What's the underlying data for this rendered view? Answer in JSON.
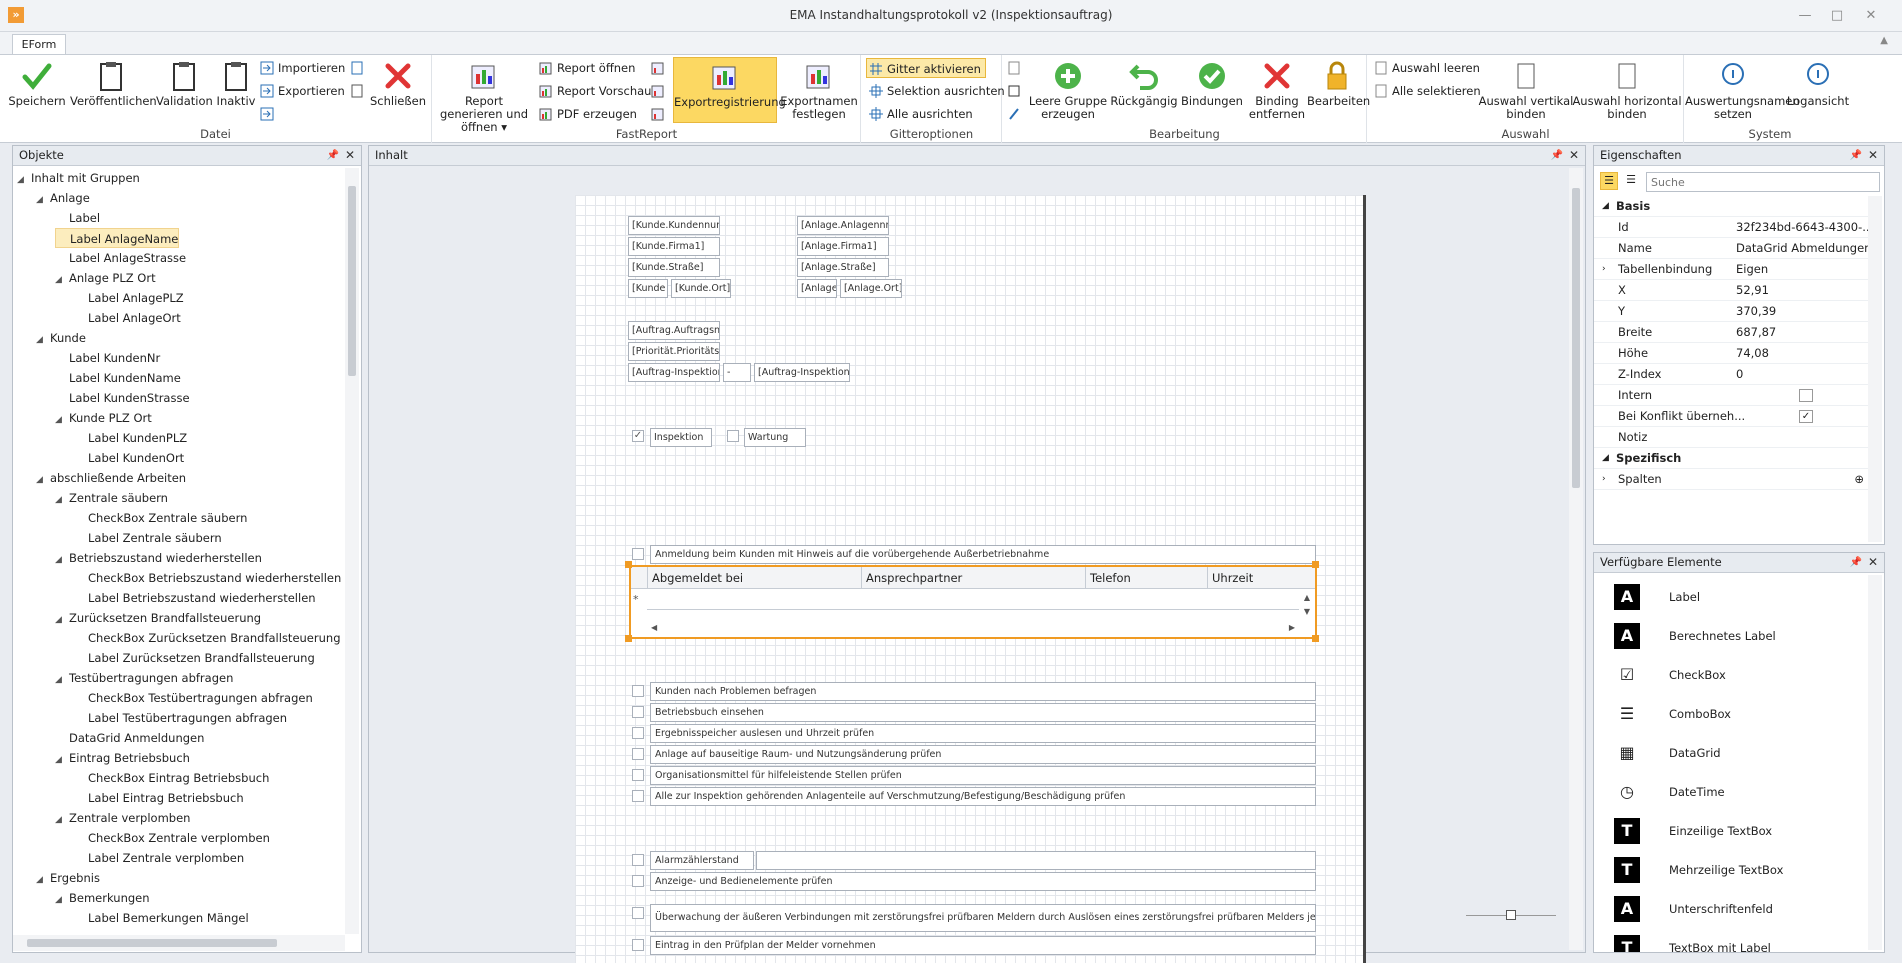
{
  "window": {
    "title": "EMA Instandhaltungsprotokoll v2 (Inspektionsauftrag)",
    "app_icon": "»",
    "minimize": "—",
    "maximize": "□",
    "close": "✕"
  },
  "ribbon": {
    "tab": "EForm",
    "groups": {
      "datei": "Datei",
      "fastreport": "FastReport",
      "gitter": "Gitteroptionen",
      "bearbeitung": "Bearbeitung",
      "auswahl": "Auswahl",
      "system": "System"
    },
    "buttons": {
      "speichern": "Speichern",
      "veroeffentlichen": "Veröffentlichen",
      "validation": "Validation",
      "inaktiv": "Inaktiv",
      "importieren": "Importieren",
      "exportieren": "Exportieren",
      "schliessen": "Schließen",
      "report_generieren": "Report generieren und öffnen ▾",
      "report_oeffnen": "Report öffnen",
      "report_vorschau": "Report Vorschau",
      "pdf_erzeugen": "PDF erzeugen",
      "exportregistrierung": "Exportregistrierung",
      "exportnamen": "Exportnamen festlegen",
      "gitter_aktivieren": "Gitter aktivieren",
      "selektion_ausrichten": "Selektion ausrichten",
      "alle_ausrichten": "Alle ausrichten",
      "leere_gruppe": "Leere Gruppe erzeugen",
      "rueckgaengig": "Rückgängig",
      "bindungen": "Bindungen",
      "binding_entfernen": "Binding entfernen",
      "bearbeiten": "Bearbeiten",
      "auswahl_leeren": "Auswahl leeren",
      "alle_selektieren": "Alle selektieren",
      "auswahl_vertikal": "Auswahl vertikal binden",
      "auswahl_horizontal": "Auswahl horizontal binden",
      "auswertungsnamen": "Auswertungsnamen setzen",
      "logansicht": "Logansicht"
    }
  },
  "objects_panel": {
    "title": "Objekte",
    "tree": [
      {
        "label": "Inhalt mit Gruppen",
        "level": 0,
        "expander": "◢"
      },
      {
        "label": "Anlage",
        "level": 1,
        "expander": "◢"
      },
      {
        "label": "Label",
        "level": 2,
        "expander": ""
      },
      {
        "label": "Label AnlageName",
        "level": 2,
        "expander": "",
        "selected": true
      },
      {
        "label": "Label AnlageStrasse",
        "level": 2,
        "expander": ""
      },
      {
        "label": "Anlage PLZ Ort",
        "level": 2,
        "expander": "◢"
      },
      {
        "label": "Label AnlagePLZ",
        "level": 3,
        "expander": ""
      },
      {
        "label": "Label AnlageOrt",
        "level": 3,
        "expander": ""
      },
      {
        "label": "Kunde",
        "level": 1,
        "expander": "◢"
      },
      {
        "label": "Label KundenNr",
        "level": 2,
        "expander": ""
      },
      {
        "label": "Label KundenName",
        "level": 2,
        "expander": ""
      },
      {
        "label": "Label KundenStrasse",
        "level": 2,
        "expander": ""
      },
      {
        "label": "Kunde PLZ Ort",
        "level": 2,
        "expander": "◢"
      },
      {
        "label": "Label KundenPLZ",
        "level": 3,
        "expander": ""
      },
      {
        "label": "Label KundenOrt",
        "level": 3,
        "expander": ""
      },
      {
        "label": "abschließende Arbeiten",
        "level": 1,
        "expander": "◢"
      },
      {
        "label": "Zentrale säubern",
        "level": 2,
        "expander": "◢"
      },
      {
        "label": "CheckBox Zentrale säubern",
        "level": 3,
        "expander": ""
      },
      {
        "label": "Label Zentrale säubern",
        "level": 3,
        "expander": ""
      },
      {
        "label": "Betriebszustand wiederherstellen",
        "level": 2,
        "expander": "◢"
      },
      {
        "label": "CheckBox Betriebszustand wiederherstellen",
        "level": 3,
        "expander": ""
      },
      {
        "label": "Label Betriebszustand wiederherstellen",
        "level": 3,
        "expander": ""
      },
      {
        "label": "Zurücksetzen Brandfallsteuerung",
        "level": 2,
        "expander": "◢"
      },
      {
        "label": "CheckBox Zurücksetzen Brandfallsteuerung",
        "level": 3,
        "expander": ""
      },
      {
        "label": "Label Zurücksetzen Brandfallsteuerung",
        "level": 3,
        "expander": ""
      },
      {
        "label": "Testübertragungen abfragen",
        "level": 2,
        "expander": "◢"
      },
      {
        "label": "CheckBox Testübertragungen abfragen",
        "level": 3,
        "expander": ""
      },
      {
        "label": "Label Testübertragungen abfragen",
        "level": 3,
        "expander": ""
      },
      {
        "label": "DataGrid Anmeldungen",
        "level": 2,
        "expander": ""
      },
      {
        "label": "Eintrag Betriebsbuch",
        "level": 2,
        "expander": "◢"
      },
      {
        "label": "CheckBox Eintrag Betriebsbuch",
        "level": 3,
        "expander": ""
      },
      {
        "label": "Label Eintrag Betriebsbuch",
        "level": 3,
        "expander": ""
      },
      {
        "label": "Zentrale verplomben",
        "level": 2,
        "expander": "◢"
      },
      {
        "label": "CheckBox Zentrale verplomben",
        "level": 3,
        "expander": ""
      },
      {
        "label": "Label Zentrale verplomben",
        "level": 3,
        "expander": ""
      },
      {
        "label": "Ergebnis",
        "level": 1,
        "expander": "◢"
      },
      {
        "label": "Bemerkungen",
        "level": 2,
        "expander": "◢"
      },
      {
        "label": "Label Bemerkungen Mängel",
        "level": 3,
        "expander": ""
      }
    ]
  },
  "content_panel": {
    "title": "Inhalt",
    "kunde_fields": [
      "[Kunde.Kundennum",
      "[Kunde.Firma1]",
      "[Kunde.Straße]",
      "[Kunde",
      "[Kunde.Ort]"
    ],
    "anlage_fields": [
      "[Anlage.Anlagennr.",
      "[Anlage.Firma1]",
      "[Anlage.Straße]",
      "[Anlage",
      "[Anlage.Ort]"
    ],
    "auftrag_fields": [
      "[Auftrag.Auftragsnr",
      "[Priorität.Prioritätsc",
      "[Auftrag-Inspektion",
      "-",
      "[Auftrag-Inspektion"
    ],
    "inspektion": "Inspektion",
    "inspektion_checked": "✓",
    "wartung": "Wartung",
    "anmeldung": "Anmeldung beim Kunden mit Hinweis auf die vorübergehende Außerbetriebnahme",
    "grid_columns": [
      "Abgemeldet bei",
      "Ansprechpartner",
      "Telefon",
      "Uhrzeit"
    ],
    "grid_new_row_marker": "*",
    "tasks": [
      "Kunden nach Problemen befragen",
      "Betriebsbuch einsehen",
      "Ergebnisspeicher auslesen und Uhrzeit prüfen",
      "Anlage auf bauseitige Raum- und Nutzungsänderung prüfen",
      "Organisationsmittel für hilfeleistende Stellen prüfen",
      "Alle zur Inspektion gehörenden Anlagenteile auf Verschmutzung/Befestigung/Beschädigung prüfen"
    ],
    "tasks2": [
      "Alarmzählerstand",
      "Anzeige- und Bedienelemente prüfen",
      "Überwachung der äußeren Verbindungen mit zerstörungsfrei prüfbaren Meldern durch Auslösen eines zerstörungsfrei prüfbaren Melders je überwach",
      "Eintrag in den Prüfplan der Melder vornehmen"
    ]
  },
  "properties_panel": {
    "title": "Eigenschaften",
    "search_placeholder": "Suche",
    "basis": "Basis",
    "spezifisch": "Spezifisch",
    "rows": [
      {
        "key": "Id",
        "value": "32f234bd-6643-4300-..."
      },
      {
        "key": "Name",
        "value": "DataGrid Abmeldungen"
      },
      {
        "key": "Tabellenbindung",
        "value": "Eigen"
      },
      {
        "key": "X",
        "value": "52,91"
      },
      {
        "key": "Y",
        "value": "370,39"
      },
      {
        "key": "Breite",
        "value": "687,87"
      },
      {
        "key": "Höhe",
        "value": "74,08"
      },
      {
        "key": "Z-Index",
        "value": "0"
      },
      {
        "key": "Intern",
        "value": ""
      },
      {
        "key": "Bei Konflikt überneh...",
        "value": "✓"
      },
      {
        "key": "Notiz",
        "value": ""
      }
    ],
    "spalten": "Spalten"
  },
  "elements_panel": {
    "title": "Verfügbare Elemente",
    "items": [
      {
        "label": "Label",
        "icon": "A"
      },
      {
        "label": "Berechnetes Label",
        "icon": "A"
      },
      {
        "label": "CheckBox",
        "icon": "☑"
      },
      {
        "label": "ComboBox",
        "icon": "☰"
      },
      {
        "label": "DataGrid",
        "icon": "▦"
      },
      {
        "label": "DateTime",
        "icon": "◷"
      },
      {
        "label": "Einzeilige TextBox",
        "icon": "T"
      },
      {
        "label": "Mehrzeilige TextBox",
        "icon": "T"
      },
      {
        "label": "Unterschriftenfeld",
        "icon": "A"
      },
      {
        "label": "TextBox mit Label",
        "icon": "T"
      }
    ]
  }
}
